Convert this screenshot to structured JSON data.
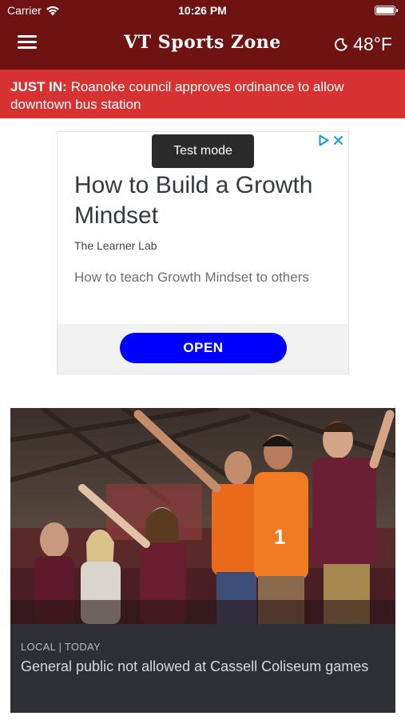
{
  "status_bar": {
    "carrier": "Carrier",
    "time": "10:26 PM",
    "wifi_icon": "wifi-icon",
    "battery_icon": "battery-icon"
  },
  "header": {
    "title": "VT Sports Zone",
    "menu_icon": "hamburger-menu-icon",
    "weather_icon": "moon-icon",
    "temperature": "48°F"
  },
  "breaking": {
    "label": "JUST IN:",
    "text": " Roanoke council approves ordinance to allow downtown bus station"
  },
  "ad": {
    "badge": "Test mode",
    "headline": "How to Build a Growth Mindset",
    "advertiser": "The Learner Lab",
    "body": "How to teach Growth Mindset to others",
    "cta": "OPEN",
    "adchoices_icon": "adchoices-icon",
    "close_icon": "close-icon",
    "cta_color": "#0000ff"
  },
  "story": {
    "meta": "LOCAL | TODAY",
    "title": "General public not allowed at Cassell Coliseum games"
  },
  "colors": {
    "header_bg": "#6e1212",
    "breaking_bg": "#d63232",
    "story_bg": "#2e2e35"
  }
}
